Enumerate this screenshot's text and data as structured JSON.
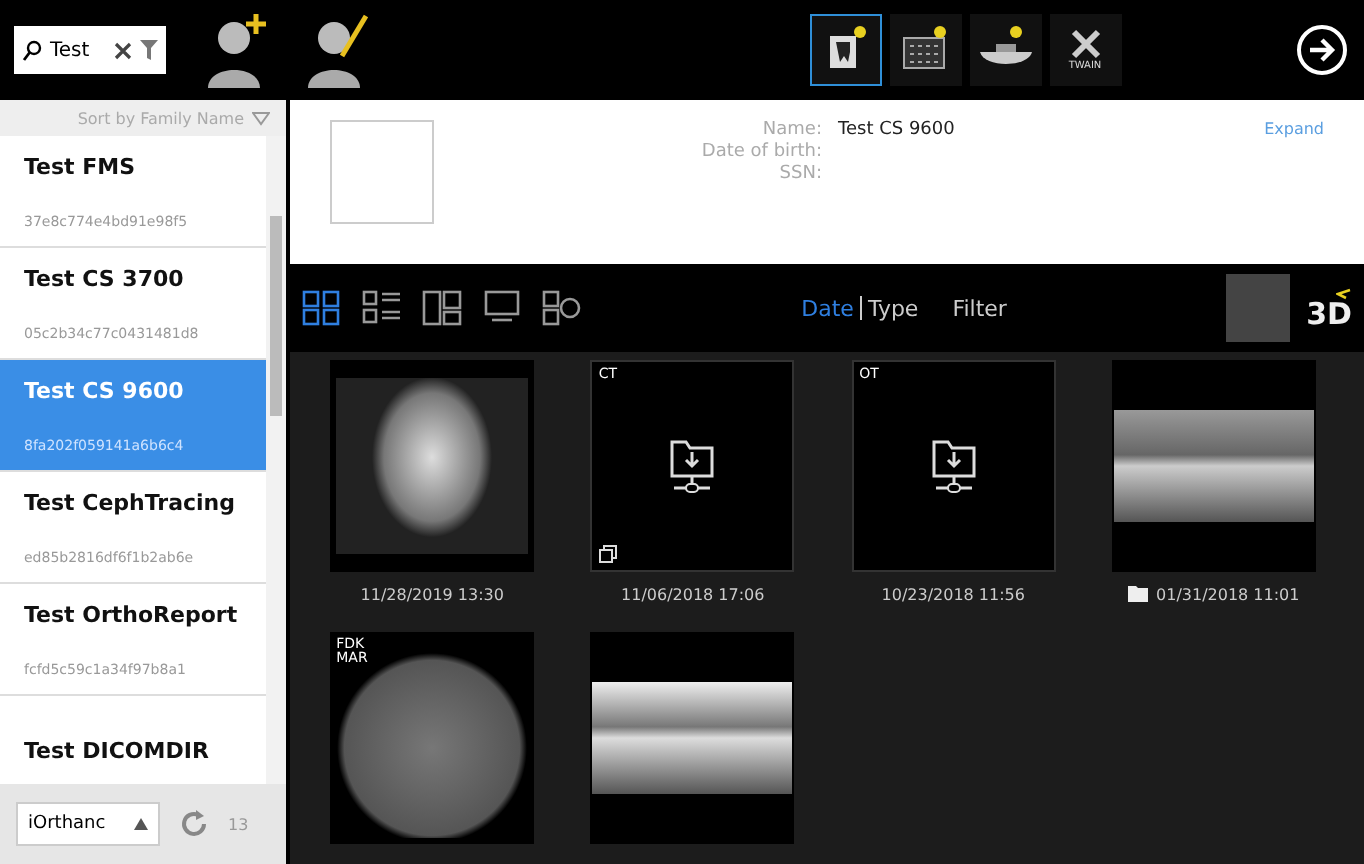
{
  "search": {
    "value": "Test"
  },
  "sort": {
    "label": "Sort by Family Name"
  },
  "patients": [
    {
      "name": "Test FMS",
      "id": "37e8c774e4bd91e98f5",
      "selected": false
    },
    {
      "name": "Test CS 3700",
      "id": "05c2b34c77c0431481d8",
      "selected": false
    },
    {
      "name": "Test CS 9600",
      "id": "8fa202f059141a6b6c4",
      "selected": true
    },
    {
      "name": "Test CephTracing",
      "id": "ed85b2816df6f1b2ab6e",
      "selected": false
    },
    {
      "name": "Test OrthoReport",
      "id": "fcfd5c59c1a34f97b8a1",
      "selected": false
    },
    {
      "name": "Test DICOMDIR",
      "selected": false
    }
  ],
  "source": {
    "value": "iOrthanc",
    "count": "13"
  },
  "devices": [
    {
      "kind": "sensor",
      "selected": true
    },
    {
      "kind": "phosphor",
      "selected": false
    },
    {
      "kind": "intraoral",
      "selected": false
    },
    {
      "kind": "twain",
      "label": "TWAIN",
      "selected": false
    }
  ],
  "patient_info": {
    "fields": [
      {
        "label": "Name:",
        "value": "Test CS 9600"
      },
      {
        "label": "Date of birth:"
      },
      {
        "label": "SSN:"
      }
    ],
    "expand": "Expand"
  },
  "views": [
    {
      "kind": "grid",
      "selected": true
    },
    {
      "kind": "list",
      "selected": false
    },
    {
      "kind": "split",
      "selected": false
    },
    {
      "kind": "slides",
      "selected": false
    },
    {
      "kind": "more",
      "selected": false
    }
  ],
  "sort_tabs": [
    {
      "label": "Date",
      "selected": true
    },
    {
      "label": "Type",
      "selected": false
    }
  ],
  "filter": "Filter",
  "view_3d": "3D",
  "images": [
    {
      "kind": "ceph",
      "date": "11/28/2019 13:30"
    },
    {
      "kind": "placeholder",
      "label": "CT",
      "stack": true,
      "date": "11/06/2018 17:06"
    },
    {
      "kind": "placeholder",
      "label": "OT",
      "date": "10/23/2018 11:56"
    },
    {
      "kind": "pano",
      "folder": true,
      "date": "01/31/2018 11:01"
    },
    {
      "kind": "axial",
      "label": "FDK MAR"
    },
    {
      "kind": "pano2"
    }
  ]
}
